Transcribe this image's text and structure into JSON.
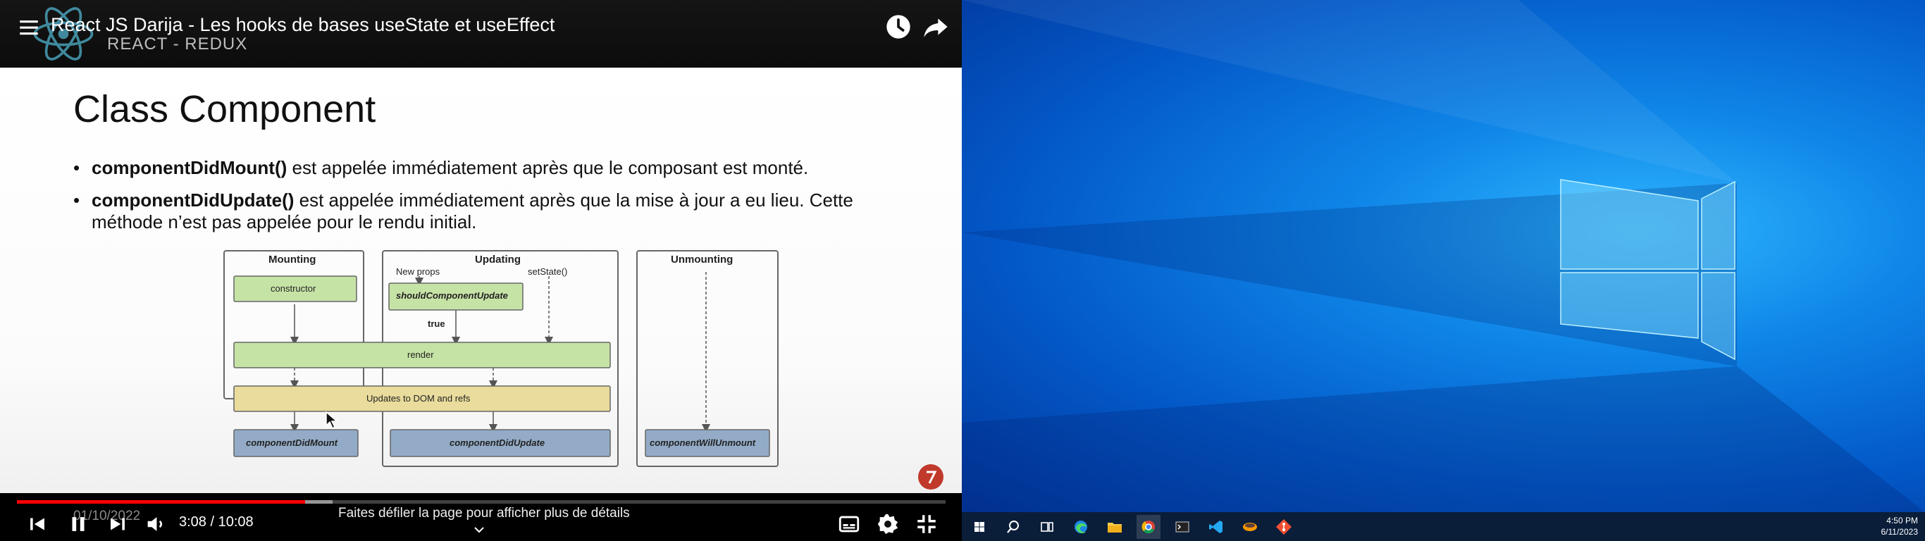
{
  "video": {
    "title": "React JS Darija - Les hooks de bases useState et useEffect",
    "channel_subtitle": "REACT - REDUX"
  },
  "slide": {
    "title": "Class Component",
    "bullet1_bold": "componentDidMount()",
    "bullet1_text": " est appelée immédiatement après que le composant est monté.",
    "bullet2_bold": "componentDidUpdate()",
    "bullet2_text": " est appelée immédiatement après que la mise à jour a eu lieu. Cette méthode n’est pas appelée pour le rendu initial.",
    "bullet_symbol": "•"
  },
  "diagram": {
    "mounting_title": "Mounting",
    "updating_title": "Updating",
    "unmounting_title": "Unmounting",
    "constructor": "constructor",
    "new_props": "New props",
    "set_state": "setState()",
    "should_update": "shouldComponentUpdate",
    "true_label": "true",
    "render": "render",
    "dom_updates": "Updates to DOM and refs",
    "did_mount": "componentDidMount",
    "did_update": "componentDidUpdate",
    "will_unmount": "componentWillUnmount",
    "colors": {
      "green": "#c6e3a6",
      "yellow": "#e9dc9c",
      "blue": "#93abc6"
    }
  },
  "player": {
    "date_overlay": "01/10/2022",
    "time": "3:08 / 10:08",
    "progress_played": 0.31,
    "progress_buffered": 0.34,
    "scroll_hint": "Faites défiler la page pour afficher plus de détails",
    "accent": "#ff0000"
  },
  "desktop": {
    "clock_time": "4:50 PM",
    "clock_date": "6/11/2023",
    "taskbar_icons": [
      "windows-start-icon",
      "search-icon",
      "task-view-icon",
      "edge-icon",
      "file-explorer-icon",
      "chrome-icon",
      "terminal-icon",
      "vscode-icon",
      "sublime-icon",
      "git-icon"
    ]
  }
}
